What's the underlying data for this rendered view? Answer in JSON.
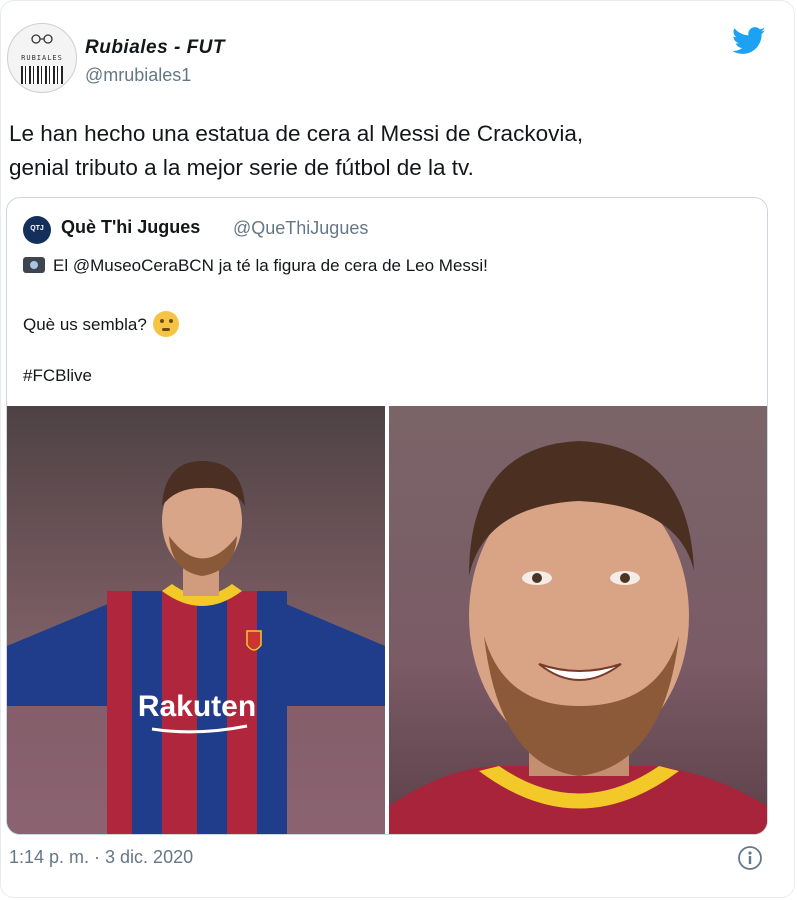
{
  "tweet": {
    "author_name": "Rubiales - FUT",
    "author_handle": "@mrubiales1",
    "avatar_text": "RUBIALES",
    "text_line1": "Le han hecho una estatua de cera al Messi de Crackovia,",
    "text_line2": "genial tributo a la mejor serie de fútbol de la tv.",
    "timestamp": "1:14 p. m. · 3 dic. 2020"
  },
  "quoted": {
    "author_name": "Què T'hi Jugues",
    "author_handle": "@QueThiJugues",
    "line1": "El @MuseoCeraBCN ja té la figura de cera de Leo Messi!",
    "line2": "Què us sembla?",
    "hashtag": "#FCBlive",
    "shirt_sponsor": "Rakuten"
  },
  "colors": {
    "twitter_blue": "#1da1f2",
    "secondary_text": "#657786",
    "border": "#ccd6dd"
  },
  "icons": {
    "brand": "twitter-bird-icon",
    "media": "camera-icon",
    "emoji": "thinking-face-icon",
    "info": "info-icon"
  }
}
